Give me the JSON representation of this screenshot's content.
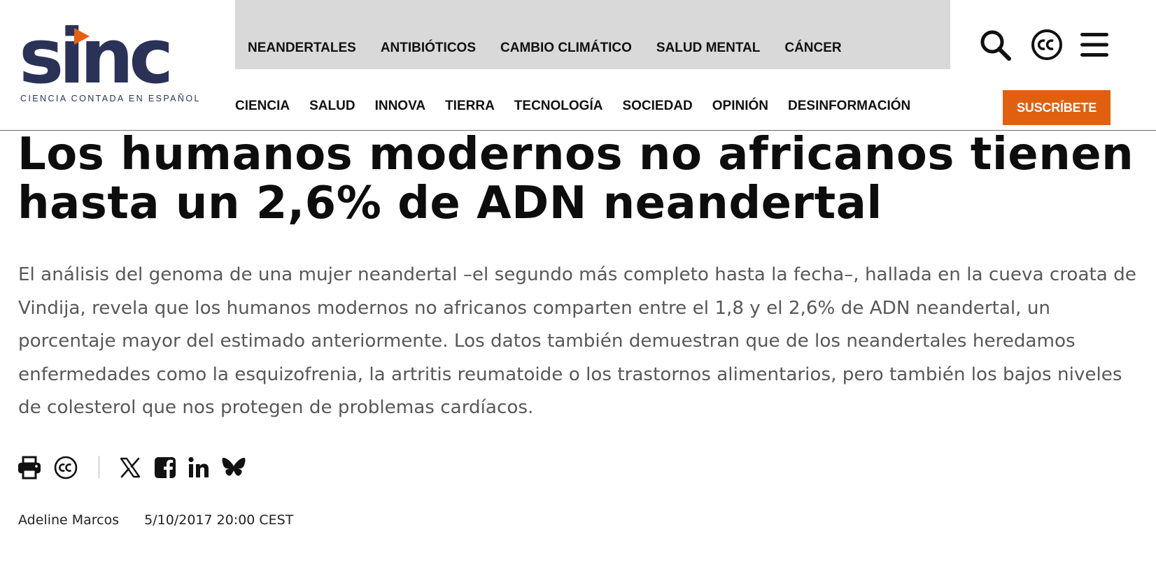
{
  "logo": {
    "word": "sinc",
    "tagline": "CIENCIA CONTADA EN ESPAÑOL"
  },
  "topics": [
    "NEANDERTALES",
    "ANTIBIÓTICOS",
    "CAMBIO CLIMÁTICO",
    "SALUD MENTAL",
    "CÁNCER"
  ],
  "nav": [
    "CIENCIA",
    "SALUD",
    "INNOVA",
    "TIERRA",
    "TECNOLOGÍA",
    "SOCIEDAD",
    "OPINIÓN",
    "DESINFORMACIÓN"
  ],
  "header_icons": [
    "search-icon",
    "creative-commons-icon",
    "menu-icon"
  ],
  "subscribe_label": "SUSCRÍBETE",
  "article": {
    "headline": "Los humanos modernos no africanos tienen hasta un 2,6% de ADN neandertal",
    "lead": "El análisis del genoma de una mujer neandertal –el segundo más completo hasta la fecha–, hallada en la cueva croata de Vindija, revela que los humanos modernos no africanos comparten entre el 1,8 y el 2,6% de ADN neandertal, un porcentaje mayor del estimado anteriormente. Los datos también demuestran que de los neandertales heredamos enfermedades como la esquizofrenia, la artritis reumatoide o los trastornos alimentarios, pero también los bajos niveles de colesterol que nos protegen de problemas cardíacos.",
    "author": "Adeline Marcos",
    "date": "5/10/2017 20:00 CEST"
  },
  "share_icons": [
    "print-icon",
    "creative-commons-icon",
    "x-icon",
    "facebook-icon",
    "linkedin-icon",
    "bluesky-icon"
  ],
  "colors": {
    "brand_navy": "#2b3258",
    "accent_orange": "#e0600f",
    "topics_bg": "#d9d9d9",
    "lead_text": "#585858"
  }
}
